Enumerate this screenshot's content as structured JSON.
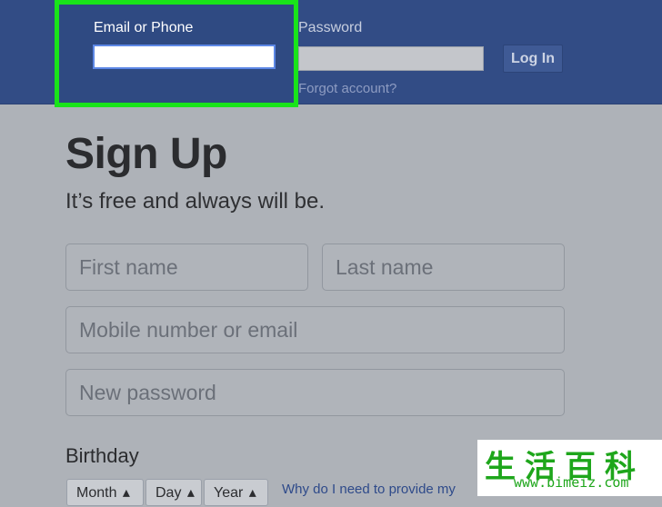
{
  "header": {
    "email_label": "Email or Phone",
    "password_label": "Password",
    "login_label": "Log In",
    "forgot_label": "Forgot account?"
  },
  "signup": {
    "title": "Sign Up",
    "subtitle": "It’s free and always will be.",
    "first_name_placeholder": "First name",
    "last_name_placeholder": "Last name",
    "mobile_placeholder": "Mobile number or email",
    "password_placeholder": "New password",
    "birthday_label": "Birthday",
    "month_label": "Month",
    "day_label": "Day",
    "year_label": "Year",
    "why_link": "Why do I need to provide my"
  },
  "watermark": {
    "chars": "生活百科",
    "url": "www.bimeiz.com"
  },
  "colors": {
    "header_blue": "#324c85",
    "highlight_green": "#19e41a",
    "page_gray": "#aeb2b8"
  }
}
